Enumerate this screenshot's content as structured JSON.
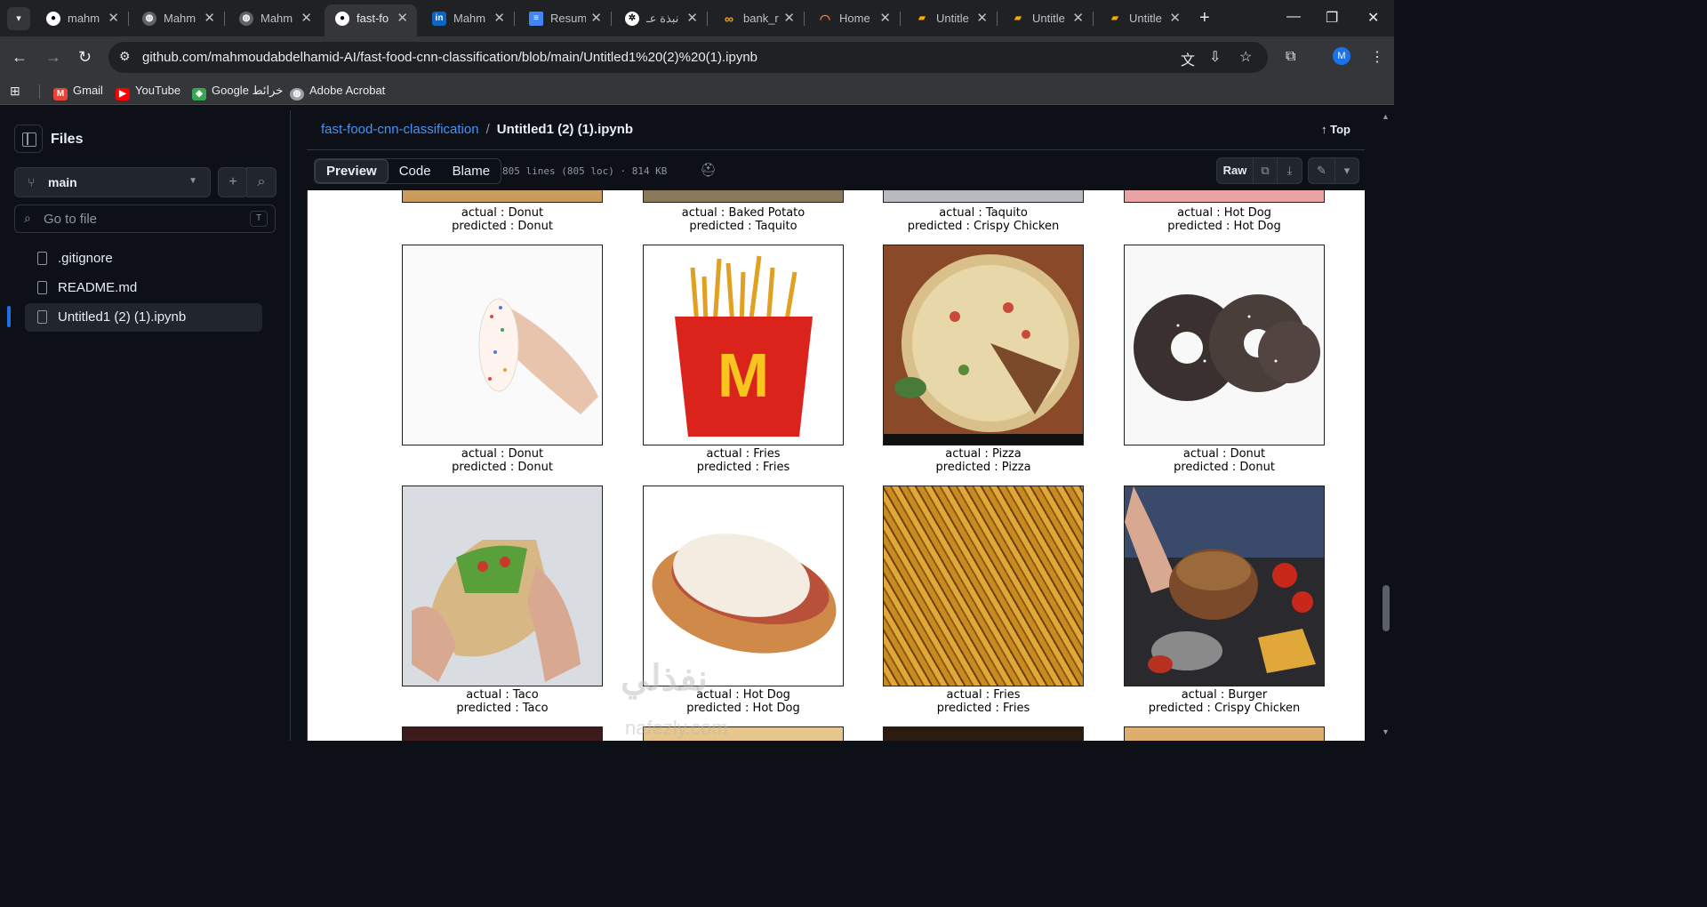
{
  "browser": {
    "tabs": [
      {
        "label": "mahm",
        "icon": "github-icon",
        "active": false
      },
      {
        "label": "Mahm",
        "icon": "globe-icon",
        "active": false
      },
      {
        "label": "Mahm",
        "icon": "globe-icon",
        "active": false
      },
      {
        "label": "fast-fo",
        "icon": "github-icon",
        "active": true
      },
      {
        "label": "Mahm",
        "icon": "linkedin-icon",
        "active": false
      },
      {
        "label": "Resum",
        "icon": "docs-icon",
        "active": false
      },
      {
        "label": "نبذة عـ",
        "icon": "chatgpt-icon",
        "active": false
      },
      {
        "label": "bank_r",
        "icon": "colab-icon",
        "active": false
      },
      {
        "label": "Home",
        "icon": "jupyter-icon",
        "active": false
      },
      {
        "label": "Untitle",
        "icon": "notebook-icon",
        "active": false
      },
      {
        "label": "Untitle",
        "icon": "notebook-icon",
        "active": false
      },
      {
        "label": "Untitle",
        "icon": "notebook-icon",
        "active": false
      }
    ],
    "url": "github.com/mahmoudabdelhamid-AI/fast-food-cnn-classification/blob/main/Untitled1%20(2)%20(1).ipynb",
    "profile_initial": "M",
    "bookmarks": [
      {
        "label": "Gmail",
        "icon": "gmail-icon",
        "color": "#ea4335"
      },
      {
        "label": "YouTube",
        "icon": "youtube-icon",
        "color": "#ff0000"
      },
      {
        "label": "Google خرائط",
        "icon": "maps-icon",
        "color": "#34a853"
      },
      {
        "label": "Adobe Acrobat",
        "icon": "globe-icon",
        "color": "#9aa0a6"
      }
    ]
  },
  "sidebar": {
    "title": "Files",
    "branch": "main",
    "search_placeholder": "Go to file",
    "search_shortcut": "T",
    "files": [
      {
        "name": ".gitignore",
        "selected": false
      },
      {
        "name": "README.md",
        "selected": false
      },
      {
        "name": "Untitled1 (2) (1).ipynb",
        "selected": true
      }
    ]
  },
  "file_header": {
    "repo_link": "fast-food-cnn-classification",
    "separator": "/",
    "file_name": "Untitled1 (2) (1).ipynb",
    "top_label": "Top",
    "view_tabs": [
      "Preview",
      "Code",
      "Blame"
    ],
    "active_tab": "Preview",
    "meta": "805 lines (805 loc) · 814 KB",
    "raw_label": "Raw"
  },
  "notebook": {
    "rows": [
      [
        {
          "actual": "actual : Donut",
          "predicted": "predicted : Donut"
        },
        {
          "actual": "actual : Baked Potato",
          "predicted": "predicted : Taquito"
        },
        {
          "actual": "actual : Taquito",
          "predicted": "predicted : Crispy Chicken"
        },
        {
          "actual": "actual : Hot Dog",
          "predicted": "predicted : Hot Dog"
        }
      ],
      [
        {
          "actual": "actual : Donut",
          "predicted": "predicted : Donut"
        },
        {
          "actual": "actual : Fries",
          "predicted": "predicted : Fries"
        },
        {
          "actual": "actual : Pizza",
          "predicted": "predicted : Pizza"
        },
        {
          "actual": "actual : Donut",
          "predicted": "predicted : Donut"
        }
      ],
      [
        {
          "actual": "actual : Taco",
          "predicted": "predicted : Taco"
        },
        {
          "actual": "actual : Hot Dog",
          "predicted": "predicted : Hot Dog"
        },
        {
          "actual": "actual : Fries",
          "predicted": "predicted : Fries"
        },
        {
          "actual": "actual : Burger",
          "predicted": "predicted : Crispy Chicken"
        }
      ]
    ]
  },
  "watermark": {
    "text": "نفذلي",
    "subtext": "nafezly.com"
  },
  "colors": {
    "link": "#4493f8",
    "accent": "#1f6feb",
    "bg": "#0d1117",
    "border": "#30363d"
  }
}
